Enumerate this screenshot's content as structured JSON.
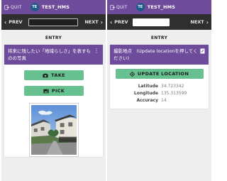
{
  "topbar": {
    "quit_label": "QUIT",
    "avatar_initials": "TE",
    "project_name": "TEST_HMS",
    "color": "#6f4c9b"
  },
  "navbar": {
    "prev_label": "PREV",
    "next_label": "NEXT",
    "left_field_value": "",
    "right_field_value": ""
  },
  "entry_title": "ENTRY",
  "photo_card": {
    "title": "将来に残したい「地域らしさ」を表すものの写真",
    "take_label": "TAKE",
    "pick_label": "PICK"
  },
  "location_card": {
    "title": "撮影地点　(Update locationを押してください)",
    "update_label": "UPDATE LOCATION",
    "rows": [
      {
        "label": "Latitude",
        "value": "34.723342"
      },
      {
        "label": "Longitude",
        "value": "135.313599"
      },
      {
        "label": "Accuracy",
        "value": "14"
      }
    ]
  },
  "colors": {
    "accent": "#6f4c9b",
    "nav": "#2f2f2f",
    "button": "#66c08f"
  }
}
